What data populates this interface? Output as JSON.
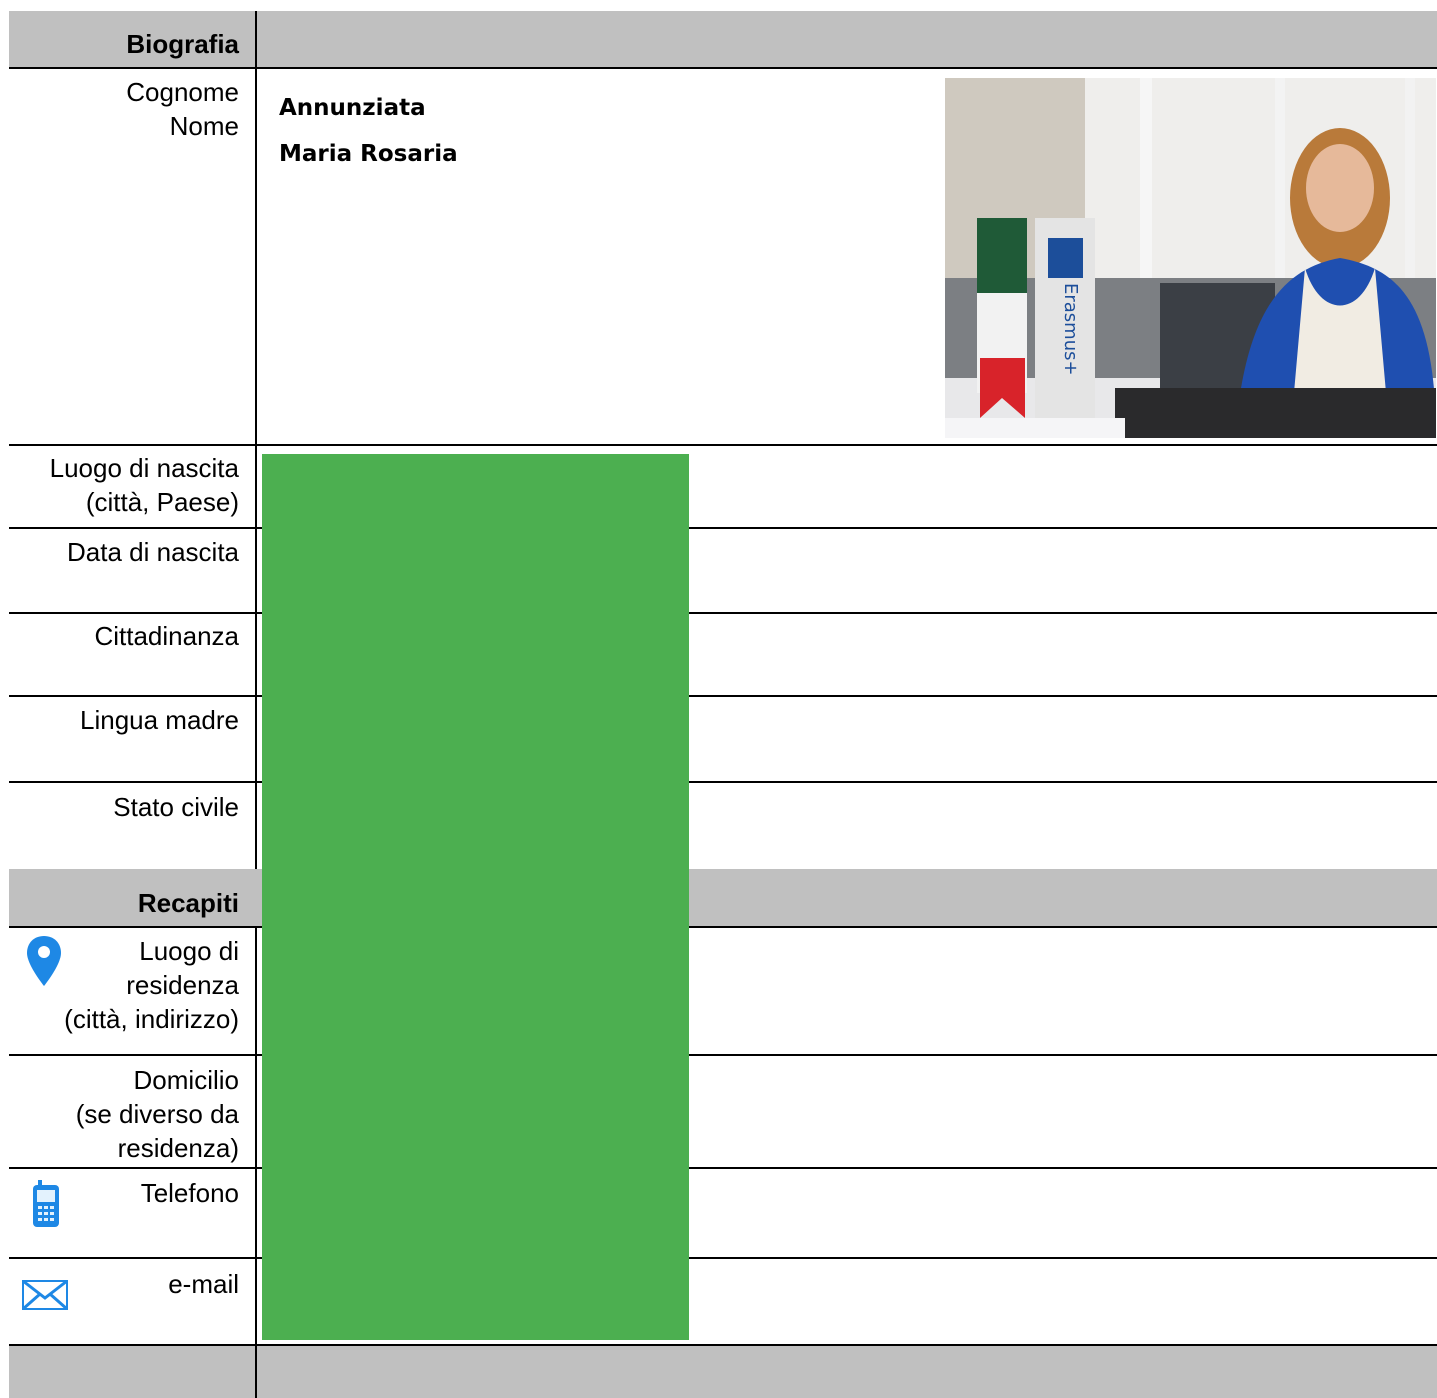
{
  "sections": {
    "biografia": "Biografia",
    "recapiti": "Recapiti"
  },
  "person": {
    "cognome": "Annunziata",
    "nome": "Maria Rosaria"
  },
  "labels": {
    "cognome_nome_line1": "Cognome",
    "cognome_nome_line2": "Nome",
    "luogo_nascita_line1": "Luogo di nascita",
    "luogo_nascita_line2": "(città, Paese)",
    "data_nascita": "Data di nascita",
    "cittadinanza": "Cittadinanza",
    "lingua_madre": "Lingua madre",
    "stato_civile": "Stato civile",
    "residenza_line1": "Luogo di",
    "residenza_line2": "residenza",
    "residenza_line3": "(città, indirizzo)",
    "domicilio_line1": "Domicilio",
    "domicilio_line2": "(se diverso da",
    "domicilio_line3": "residenza)",
    "telefono": "Telefono",
    "email": "e-mail"
  },
  "photo": {
    "flag_text": "Erasmus+"
  },
  "icons": {
    "location": "map-pin-icon",
    "phone": "mobile-phone-icon",
    "email": "envelope-icon"
  },
  "colors": {
    "header_gray": "#c0c0c0",
    "redaction_green": "#4caf50",
    "icon_blue": "#1e88e5"
  }
}
